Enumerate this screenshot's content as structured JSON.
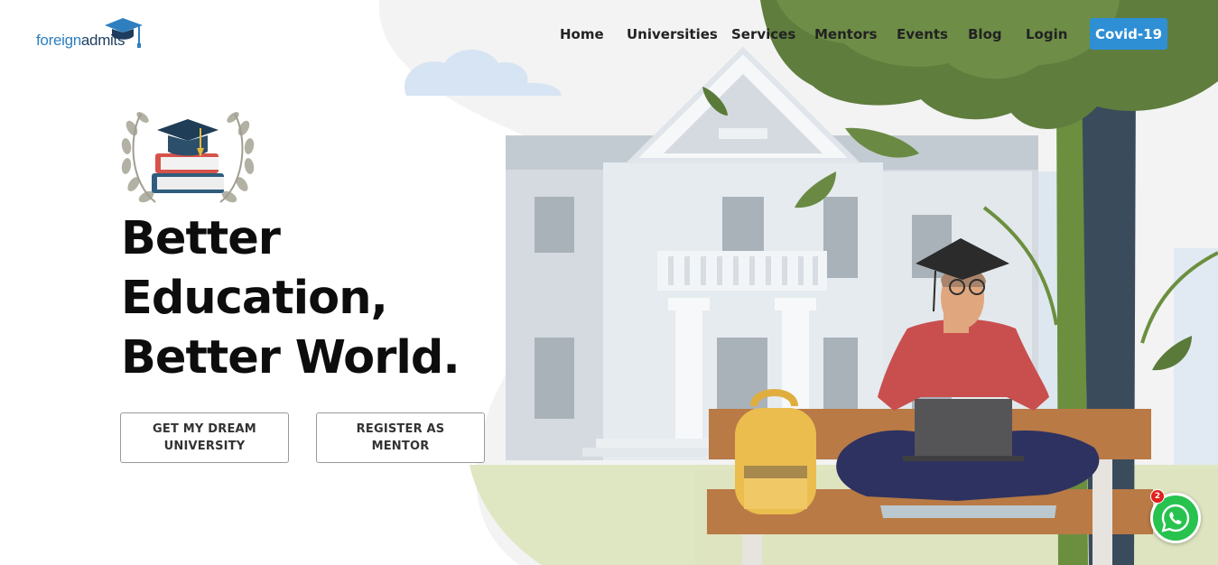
{
  "brand": {
    "name_part1": "foreign",
    "name_part2": "admits",
    "colors": {
      "primary": "#2d7fc0",
      "dark": "#1d3c5e"
    }
  },
  "nav": {
    "items": [
      {
        "label": "Home"
      },
      {
        "label": "Universities"
      },
      {
        "label": "Services"
      },
      {
        "label": "Mentors"
      },
      {
        "label": "Events"
      },
      {
        "label": "Blog"
      },
      {
        "label": "Login"
      }
    ],
    "covid_label": "Covid-19",
    "covid_color": "#2f8fd5"
  },
  "hero": {
    "emblem_icon": "graduation-emblem-icon",
    "headline_lines": [
      "Better",
      "Education,",
      "Better World."
    ],
    "cta_primary": "GET MY DREAM UNIVERSITY",
    "cta_secondary": "REGISTER AS MENTOR"
  },
  "illustration": {
    "description_icon": "student-on-bench-campus-illustration",
    "colors": {
      "building": "#d9dfe4",
      "tree": "#5e7d3c",
      "bench": "#b97a45",
      "shirt": "#c94f4f",
      "pants": "#2e3260",
      "bag": "#eabd4e"
    }
  },
  "whatsapp": {
    "icon": "whatsapp-icon",
    "badge_count": "2",
    "color": "#28c24f"
  }
}
